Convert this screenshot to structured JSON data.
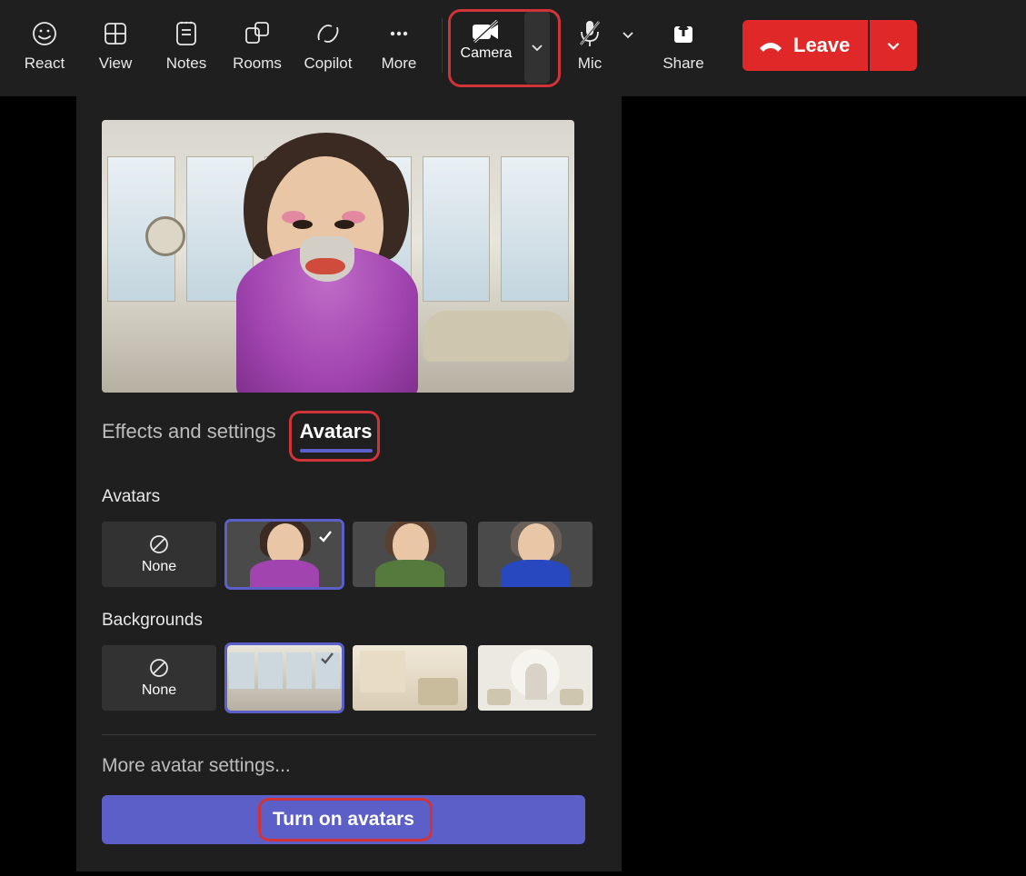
{
  "toolbar": {
    "react": "React",
    "view": "View",
    "notes": "Notes",
    "rooms": "Rooms",
    "copilot": "Copilot",
    "more": "More",
    "camera": "Camera",
    "mic": "Mic",
    "share": "Share",
    "leave": "Leave"
  },
  "panel": {
    "tabs": {
      "effects": "Effects and settings",
      "avatars": "Avatars"
    },
    "sections": {
      "avatars": "Avatars",
      "backgrounds": "Backgrounds"
    },
    "none": "None",
    "more_settings": "More avatar settings...",
    "turn_on": "Turn on avatars"
  },
  "colors": {
    "accent": "#5b5fc7",
    "danger": "#e02828",
    "highlight": "#d13438"
  },
  "highlights": [
    "camera-button",
    "tab-avatars",
    "turn-on-avatars-button-text"
  ]
}
